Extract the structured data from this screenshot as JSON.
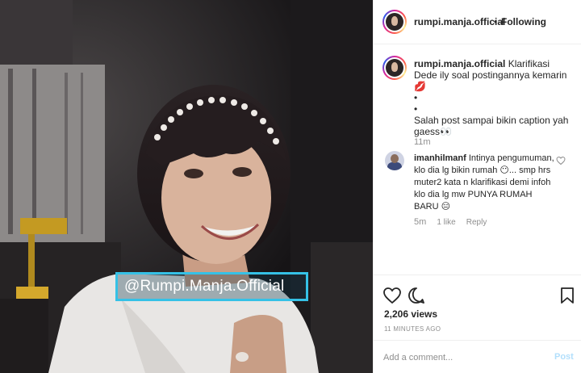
{
  "media": {
    "watermark_text": "@Rumpi.Manja.Official"
  },
  "header": {
    "username": "rumpi.manja.official",
    "separator": "•",
    "follow_status": "Following"
  },
  "caption": {
    "username": "rumpi.manja.official",
    "line1": "Klarifikasi Dede ily soal postingannya kemarin 💋",
    "line2": "•",
    "line3": "•",
    "line4": "Salah post sampai bikin caption yah gaess👀",
    "time": "11m"
  },
  "comments": [
    {
      "username": "imanhilmanf",
      "text": "Intinya pengumuman, klo dia lg bikin rumah 😶... smp hrs muter2 kata n klarifikasi demi infoh klo dia lg mw PUNYA RUMAH BARU 😑",
      "time": "5m",
      "likes": "1 like",
      "reply": "Reply"
    }
  ],
  "stats": {
    "views": "2,206 views",
    "posted_ago": "11 MINUTES AGO"
  },
  "composer": {
    "placeholder": "Add a comment...",
    "post_label": "Post"
  },
  "colors": {
    "watermark_border": "#35c1e6",
    "post_button_disabled": "#b2dffc",
    "muted_text": "#8e8e8e"
  }
}
